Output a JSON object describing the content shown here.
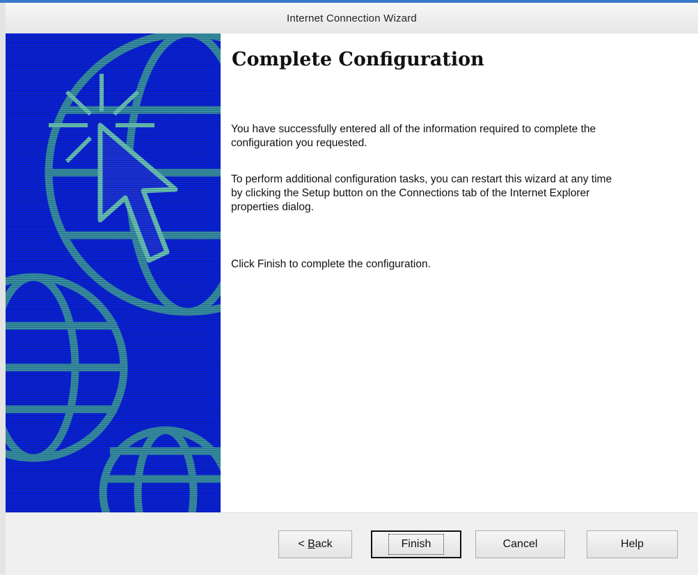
{
  "window": {
    "title": "Internet Connection Wizard"
  },
  "content": {
    "heading": "Complete Configuration",
    "paragraphs": [
      "You have successfully entered all of the information required to complete the configuration you requested.",
      "To perform additional configuration tasks, you can restart this wizard at any time by clicking the Setup button on the Connections tab of the Internet Explorer properties dialog.",
      "Click Finish to complete the configuration."
    ]
  },
  "buttons": {
    "back_prefix": "< ",
    "back_mnemonic": "B",
    "back_rest": "ack",
    "finish": "Finish",
    "cancel": "Cancel",
    "help": "Help"
  },
  "colors": {
    "art_background": "#0a22d6",
    "art_lines": "#3fa39a",
    "titlebar_accent": "#3a78c9"
  },
  "icons": [
    "globe-icon",
    "cursor-arrow-icon",
    "sparkle-icon"
  ]
}
